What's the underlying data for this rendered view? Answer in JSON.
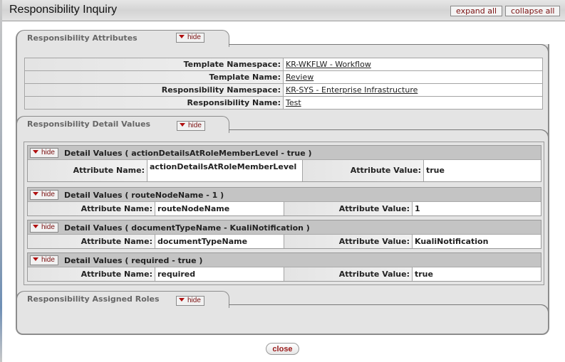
{
  "header": {
    "title": "Responsibility Inquiry",
    "expand_all": "expand all",
    "collapse_all": "collapse all"
  },
  "sections": {
    "attributes": {
      "title": "Responsibility Attributes",
      "toggle": "hide",
      "rows": [
        {
          "label": "Template Namespace:",
          "value": "KR-WKFLW - Workflow"
        },
        {
          "label": "Template Name:",
          "value": "Review"
        },
        {
          "label": "Responsibility Namespace:",
          "value": "KR-SYS - Enterprise Infrastructure"
        },
        {
          "label": "Responsibility Name:",
          "value": "Test"
        }
      ]
    },
    "detail_values": {
      "title": "Responsibility Detail Values",
      "toggle": "hide",
      "items": [
        {
          "toggle": "hide",
          "title": "Detail Values ( actionDetailsAtRoleMemberLevel - true )",
          "name_label": "Attribute Name:",
          "name_value": "actionDetailsAtRoleMemberLevel",
          "value_label": "Attribute Value:",
          "value_value": "true"
        },
        {
          "toggle": "hide",
          "title": "Detail Values ( routeNodeName - 1 )",
          "name_label": "Attribute Name:",
          "name_value": "routeNodeName",
          "value_label": "Attribute Value:",
          "value_value": "1"
        },
        {
          "toggle": "hide",
          "title": "Detail Values ( documentTypeName - KualiNotification )",
          "name_label": "Attribute Name:",
          "name_value": "documentTypeName",
          "value_label": "Attribute Value:",
          "value_value": "KualiNotification"
        },
        {
          "toggle": "hide",
          "title": "Detail Values ( required - true )",
          "name_label": "Attribute Name:",
          "name_value": "required",
          "value_label": "Attribute Value:",
          "value_value": "true"
        }
      ]
    },
    "assigned_roles": {
      "title": "Responsibility Assigned Roles",
      "toggle": "hide"
    }
  },
  "footer": {
    "close": "close"
  },
  "colors": {
    "accent": "#7a1010",
    "panel_bg": "#e4e4e4",
    "subheader_bg": "#c4c4c4"
  }
}
